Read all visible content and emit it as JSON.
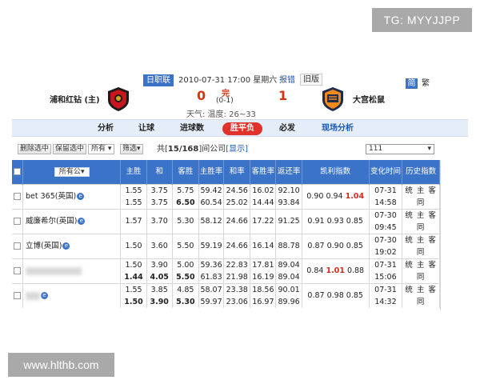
{
  "watermarks": {
    "top": "TG: MYYJJPP",
    "bottom": "www.hlthb.com"
  },
  "match": {
    "league": "日职联",
    "datetime": "2010-07-31 17:00 星期六",
    "report_link": "报错",
    "old_version": "旧版",
    "lang_simplified": "简",
    "lang_traditional": "繁",
    "home_team": "浦和红钻 (主)",
    "away_team": "大宫松鼠",
    "home_score": "0",
    "away_score": "1",
    "status": "完",
    "halftime": "(0-1)",
    "weather": "天气:   温度:  26~33"
  },
  "nav": {
    "items": [
      "分析",
      "让球",
      "进球数",
      "胜平负",
      "必发",
      "现场分析"
    ]
  },
  "toolbar": {
    "delete_selected": "删除选中",
    "keep_selected": "保留选中",
    "filter_all": "所有",
    "filter": "筛选",
    "count_prefix": "共[",
    "count_value": "15/168",
    "count_suffix": "]间公司",
    "show_link": "[显示]",
    "right_select": "111"
  },
  "table": {
    "headers": {
      "all_companies": "所有公",
      "home_win": "主胜",
      "draw": "和",
      "away_win": "客胜",
      "home_rate": "主胜率",
      "draw_rate": "和率",
      "away_rate": "客胜率",
      "return_rate": "返还率",
      "kelly": "凯利指数",
      "change_time": "变化时间",
      "history": "历史指数"
    },
    "history_links": "统 主 客 同",
    "rows": [
      {
        "company": "bet 365(英国)",
        "lines": [
          {
            "h": "1.55",
            "d": "3.75",
            "a": "5.75",
            "hr": "59.42",
            "dr": "24.56",
            "ar": "16.02",
            "rr": "92.10",
            "k1": "0.90",
            "k2": "0.94",
            "k3": "1.04"
          },
          {
            "h": "1.55",
            "d": "3.75",
            "a": "6.50",
            "hr": "60.54",
            "dr": "25.02",
            "ar": "14.44",
            "rr": "93.84"
          }
        ],
        "time": [
          "07-31",
          "14:58"
        ]
      },
      {
        "company": "威廉希尔(英国)",
        "lines": [
          {
            "h": "1.57",
            "d": "3.70",
            "a": "5.30",
            "hr": "58.12",
            "dr": "24.66",
            "ar": "17.22",
            "rr": "91.25",
            "k1": "0.91",
            "k2": "0.93",
            "k3": "0.85"
          }
        ],
        "time": [
          "07-30",
          "09:45"
        ]
      },
      {
        "company": "立博(英国)",
        "lines": [
          {
            "h": "1.50",
            "d": "3.60",
            "a": "5.50",
            "hr": "59.19",
            "dr": "24.66",
            "ar": "16.14",
            "rr": "88.78",
            "k1": "0.87",
            "k2": "0.90",
            "k3": "0.85"
          }
        ],
        "time": [
          "07-30",
          "19:02"
        ]
      },
      {
        "company": "",
        "lines": [
          {
            "h": "1.50",
            "d": "3.90",
            "a": "5.00",
            "hr": "59.36",
            "dr": "22.83",
            "ar": "17.81",
            "rr": "89.04",
            "k1": "0.84",
            "k2": "1.01",
            "k3": "0.88"
          },
          {
            "h": "1.44",
            "d": "4.05",
            "a": "5.50",
            "hr": "61.83",
            "dr": "21.98",
            "ar": "16.19",
            "rr": "89.04"
          }
        ],
        "time": [
          "07-31",
          "15:06"
        ]
      },
      {
        "company": "",
        "lines": [
          {
            "h": "1.55",
            "d": "3.85",
            "a": "4.85",
            "hr": "58.07",
            "dr": "23.38",
            "ar": "18.56",
            "rr": "90.01",
            "k1": "0.87",
            "k2": "0.98",
            "k3": "0.85"
          },
          {
            "h": "1.50",
            "d": "3.90",
            "a": "5.30",
            "hr": "59.97",
            "dr": "23.06",
            "ar": "16.97",
            "rr": "89.96"
          }
        ],
        "time": [
          "07-31",
          "14:32"
        ]
      }
    ]
  }
}
